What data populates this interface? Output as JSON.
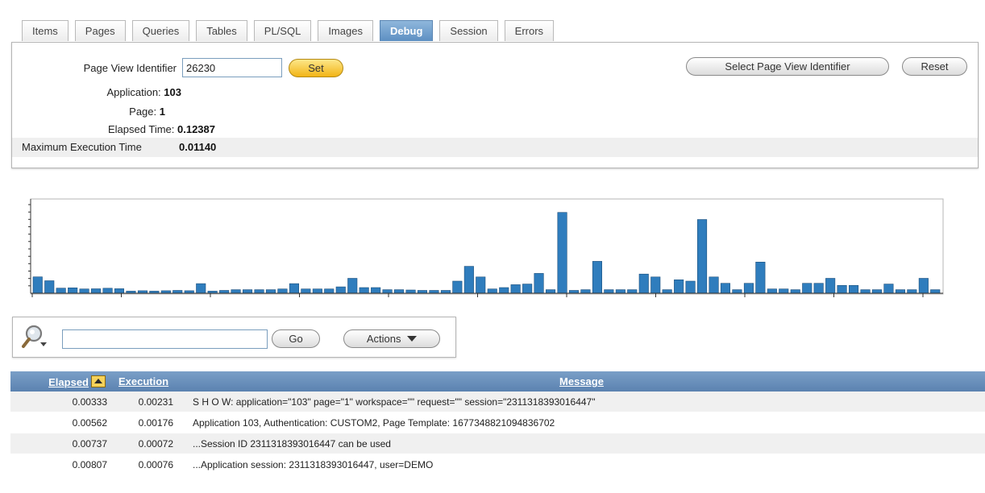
{
  "tabs": [
    {
      "label": "Items"
    },
    {
      "label": "Pages"
    },
    {
      "label": "Queries"
    },
    {
      "label": "Tables"
    },
    {
      "label": "PL/SQL"
    },
    {
      "label": "Images"
    },
    {
      "label": "Debug",
      "active": true
    },
    {
      "label": "Session"
    },
    {
      "label": "Errors"
    }
  ],
  "debug_panel": {
    "pvi_label": "Page View Identifier",
    "pvi_value": "26230",
    "set_button": "Set",
    "select_pvi_button": "Select Page View Identifier",
    "reset_button": "Reset",
    "application_label": "Application:",
    "application_value": "103",
    "page_label": "Page:",
    "page_value": "1",
    "elapsed_label": "Elapsed Time:",
    "elapsed_value": "0.12387",
    "max_exec_label": "Maximum Execution Time",
    "max_exec_value": "0.01140"
  },
  "chart_data": {
    "type": "bar",
    "color": "#2f7dbd",
    "values": [
      0.00231,
      0.00176,
      0.00072,
      0.00076,
      0.0006,
      0.00062,
      0.0007,
      0.00064,
      0.0003,
      0.00035,
      0.0003,
      0.00035,
      0.0004,
      0.00035,
      0.00135,
      0.0003,
      0.0004,
      0.0005,
      0.0005,
      0.0005,
      0.0005,
      0.0006,
      0.00135,
      0.0006,
      0.0006,
      0.0006,
      0.0009,
      0.0021,
      0.0008,
      0.0008,
      0.0005,
      0.0005,
      0.00045,
      0.0004,
      0.0004,
      0.0004,
      0.0017,
      0.0038,
      0.0023,
      0.0006,
      0.0008,
      0.0012,
      0.0013,
      0.0028,
      0.0005,
      0.0114,
      0.0004,
      0.0005,
      0.0045,
      0.0005,
      0.0005,
      0.0005,
      0.0027,
      0.0023,
      0.0005,
      0.0019,
      0.0017,
      0.0104,
      0.0023,
      0.0014,
      0.0005,
      0.0014,
      0.0044,
      0.0006,
      0.0006,
      0.0005,
      0.0014,
      0.0014,
      0.0021,
      0.0011,
      0.0011,
      0.0005,
      0.0005,
      0.0013,
      0.0005,
      0.0005,
      0.0021,
      0.0005
    ],
    "ylim": [
      0,
      0.0125
    ]
  },
  "search": {
    "placeholder": "",
    "go_button": "Go",
    "actions_button": "Actions"
  },
  "table": {
    "columns": [
      "Elapsed",
      "Execution",
      "Message"
    ],
    "rows": [
      {
        "elapsed": "0.00333",
        "execution": "0.00231",
        "message": "S H O W: application=\"103\" page=\"1\" workspace=\"\" request=\"\" session=\"2311318393016447\""
      },
      {
        "elapsed": "0.00562",
        "execution": "0.00176",
        "message": "Application 103, Authentication: CUSTOM2, Page Template: 1677348821094836702"
      },
      {
        "elapsed": "0.00737",
        "execution": "0.00072",
        "message": "...Session ID 2311318393016447 can be used"
      },
      {
        "elapsed": "0.00807",
        "execution": "0.00076",
        "message": "...Application session: 2311318393016447, user=DEMO"
      }
    ]
  }
}
